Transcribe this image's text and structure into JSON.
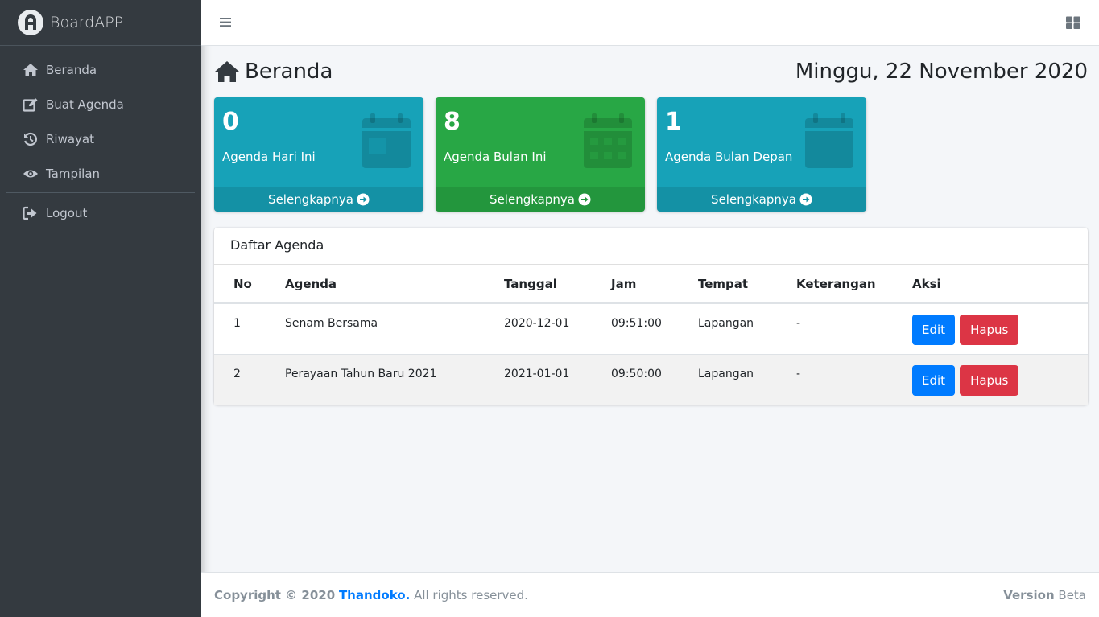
{
  "brand": {
    "name": "BoardAPP"
  },
  "sidebar": {
    "items": [
      {
        "label": "Beranda",
        "icon": "home-icon"
      },
      {
        "label": "Buat Agenda",
        "icon": "edit-icon"
      },
      {
        "label": "Riwayat",
        "icon": "history-icon"
      },
      {
        "label": "Tampilan",
        "icon": "eye-icon"
      },
      {
        "label": "Logout",
        "icon": "logout-icon"
      }
    ]
  },
  "page": {
    "title": "Beranda",
    "date": "Minggu, 22 November 2020"
  },
  "boxes": [
    {
      "count": "0",
      "label": "Agenda Hari Ini",
      "more": "Selengkapnya",
      "color": "#17a2b8"
    },
    {
      "count": "8",
      "label": "Agenda Bulan Ini",
      "more": "Selengkapnya",
      "color": "#28a745"
    },
    {
      "count": "1",
      "label": "Agenda Bulan Depan",
      "more": "Selengkapnya",
      "color": "#17a2b8"
    }
  ],
  "agenda": {
    "title": "Daftar Agenda",
    "columns": [
      "No",
      "Agenda",
      "Tanggal",
      "Jam",
      "Tempat",
      "Keterangan",
      "Aksi"
    ],
    "rows": [
      {
        "no": "1",
        "agenda": "Senam Bersama",
        "tanggal": "2020-12-01",
        "jam": "09:51:00",
        "tempat": "Lapangan",
        "keterangan": "-",
        "edit": "Edit",
        "hapus": "Hapus"
      },
      {
        "no": "2",
        "agenda": "Perayaan Tahun Baru 2021",
        "tanggal": "2021-01-01",
        "jam": "09:50:00",
        "tempat": "Lapangan",
        "keterangan": "-",
        "edit": "Edit",
        "hapus": "Hapus"
      }
    ]
  },
  "footer": {
    "copyright": "Copyright © 2020",
    "author": "Thandoko.",
    "rights": "All rights reserved.",
    "version_label": "Version",
    "version_value": "Beta"
  },
  "colors": {
    "sidebar": "#343a40",
    "primary": "#007bff",
    "danger": "#dc3545",
    "info": "#17a2b8",
    "success": "#28a745"
  }
}
